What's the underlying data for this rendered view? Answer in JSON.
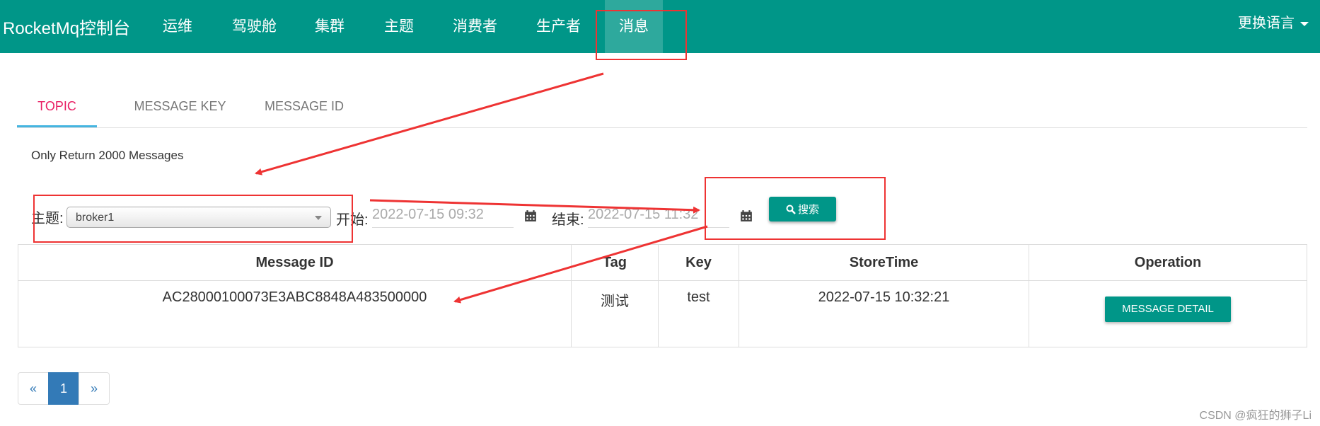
{
  "navbar": {
    "brand": "RocketMq控制台",
    "items": [
      "运维",
      "驾驶舱",
      "集群",
      "主题",
      "消费者",
      "生产者",
      "消息"
    ],
    "active_item": "消息",
    "language_menu": "更换语言"
  },
  "tabs": [
    "TOPIC",
    "MESSAGE KEY",
    "MESSAGE ID"
  ],
  "active_tab": "TOPIC",
  "notice": "Only Return 2000 Messages",
  "query": {
    "topic_label": "主题:",
    "topic_value": "broker1",
    "start_label": "开始:",
    "start_value": "2022-07-15 09:32",
    "end_label": "结束:",
    "end_value": "2022-07-15 11:32",
    "search_label": "搜索"
  },
  "table": {
    "headers": [
      "Message ID",
      "Tag",
      "Key",
      "StoreTime",
      "Operation"
    ],
    "rows": [
      {
        "message_id": "AC28000100073E3ABC8848A483500000",
        "tag": "测试",
        "key": "test",
        "store_time": "2022-07-15 10:32:21",
        "operation": "MESSAGE DETAIL"
      }
    ]
  },
  "pagination": {
    "prev": "«",
    "current": "1",
    "next": "»"
  },
  "watermark": "CSDN @疯狂的狮子Li",
  "colors": {
    "primary": "#009688",
    "active_tab": "#e91e63",
    "annotation": "#ee3333",
    "page_active": "#337ab7"
  },
  "icons": [
    "search-icon",
    "calendar-icon",
    "chevron-down-icon"
  ]
}
